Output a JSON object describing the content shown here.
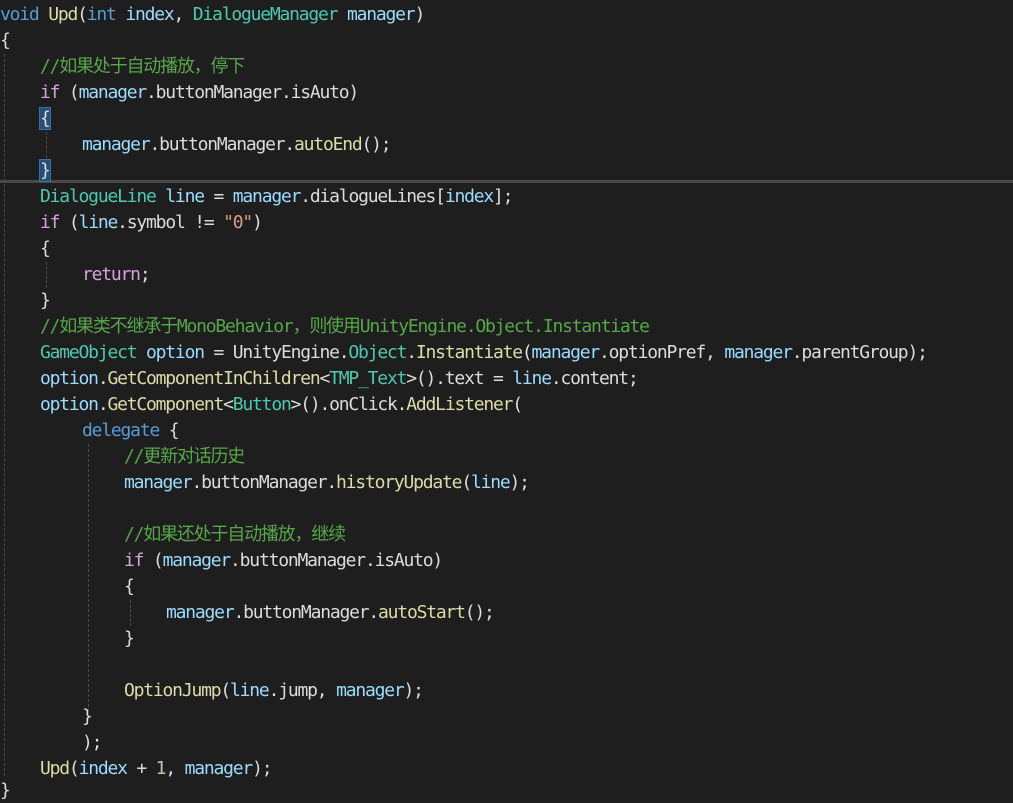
{
  "colors": {
    "background": "#1e1e1e",
    "keyword": "#569cd6",
    "type": "#4ec9b0",
    "method": "#dcdcaa",
    "parameter": "#9cdcfe",
    "plain": "#dcdcdc",
    "comment": "#57a64a",
    "string": "#d69d85",
    "number": "#b5cea8",
    "control": "#d8a0df",
    "brace_highlight": "#264f78"
  },
  "code_lines": [
    [
      [
        "kw",
        "void "
      ],
      [
        "method",
        "Upd"
      ],
      [
        "plain",
        "("
      ],
      [
        "kw",
        "int"
      ],
      [
        "plain",
        " "
      ],
      [
        "param",
        "index"
      ],
      [
        "plain",
        ", "
      ],
      [
        "type",
        "DialogueManager"
      ],
      [
        "plain",
        " "
      ],
      [
        "param",
        "manager"
      ],
      [
        "plain",
        ")"
      ]
    ],
    [
      [
        "plain",
        "{"
      ]
    ],
    [
      [
        "comment",
        "//如果处于自动播放，停下"
      ]
    ],
    [
      [
        "ctrl",
        "if"
      ],
      [
        "plain",
        " ("
      ],
      [
        "param",
        "manager"
      ],
      [
        "plain",
        "."
      ],
      [
        "plain",
        "buttonManager"
      ],
      [
        "plain",
        "."
      ],
      [
        "plain",
        "isAuto"
      ],
      [
        "plain",
        ")"
      ]
    ],
    [
      [
        "plain",
        "{"
      ]
    ],
    [
      [
        "param",
        "manager"
      ],
      [
        "plain",
        "."
      ],
      [
        "plain",
        "buttonManager"
      ],
      [
        "plain",
        "."
      ],
      [
        "method",
        "autoEnd"
      ],
      [
        "plain",
        "();"
      ]
    ],
    [
      [
        "plain",
        "}"
      ]
    ],
    [
      [
        "type",
        "DialogueLine"
      ],
      [
        "plain",
        " "
      ],
      [
        "param",
        "line"
      ],
      [
        "plain",
        " = "
      ],
      [
        "param",
        "manager"
      ],
      [
        "plain",
        "."
      ],
      [
        "plain",
        "dialogueLines"
      ],
      [
        "plain",
        "["
      ],
      [
        "param",
        "index"
      ],
      [
        "plain",
        "];"
      ]
    ],
    [
      [
        "ctrl",
        "if"
      ],
      [
        "plain",
        " ("
      ],
      [
        "param",
        "line"
      ],
      [
        "plain",
        "."
      ],
      [
        "plain",
        "symbol"
      ],
      [
        "plain",
        " != "
      ],
      [
        "string",
        "\"0\""
      ],
      [
        "plain",
        ")"
      ]
    ],
    [
      [
        "plain",
        "{"
      ]
    ],
    [
      [
        "ctrl",
        "return"
      ],
      [
        "plain",
        ";"
      ]
    ],
    [
      [
        "plain",
        "}"
      ]
    ],
    [
      [
        "comment",
        "//如果类不继承于MonoBehavior，则使用UnityEngine.Object.Instantiate"
      ]
    ],
    [
      [
        "type",
        "GameObject"
      ],
      [
        "plain",
        " "
      ],
      [
        "param",
        "option"
      ],
      [
        "plain",
        " = "
      ],
      [
        "plain",
        "UnityEngine"
      ],
      [
        "plain",
        "."
      ],
      [
        "type",
        "Object"
      ],
      [
        "plain",
        "."
      ],
      [
        "method",
        "Instantiate"
      ],
      [
        "plain",
        "("
      ],
      [
        "param",
        "manager"
      ],
      [
        "plain",
        "."
      ],
      [
        "plain",
        "optionPref"
      ],
      [
        "plain",
        ", "
      ],
      [
        "param",
        "manager"
      ],
      [
        "plain",
        "."
      ],
      [
        "plain",
        "parentGroup"
      ],
      [
        "plain",
        ");"
      ]
    ],
    [
      [
        "param",
        "option"
      ],
      [
        "plain",
        "."
      ],
      [
        "method",
        "GetComponentInChildren"
      ],
      [
        "plain",
        "<"
      ],
      [
        "type",
        "TMP_Text"
      ],
      [
        "plain",
        ">()."
      ],
      [
        "plain",
        "text"
      ],
      [
        "plain",
        " = "
      ],
      [
        "param",
        "line"
      ],
      [
        "plain",
        "."
      ],
      [
        "plain",
        "content"
      ],
      [
        "plain",
        ";"
      ]
    ],
    [
      [
        "param",
        "option"
      ],
      [
        "plain",
        "."
      ],
      [
        "method",
        "GetComponent"
      ],
      [
        "plain",
        "<"
      ],
      [
        "type",
        "Button"
      ],
      [
        "plain",
        ">()."
      ],
      [
        "plain",
        "onClick"
      ],
      [
        "plain",
        "."
      ],
      [
        "method",
        "AddListener"
      ],
      [
        "plain",
        "("
      ]
    ],
    [
      [
        "kw",
        "delegate"
      ],
      [
        "plain",
        " {"
      ]
    ],
    [
      [
        "comment",
        "//更新对话历史"
      ]
    ],
    [
      [
        "param",
        "manager"
      ],
      [
        "plain",
        "."
      ],
      [
        "plain",
        "buttonManager"
      ],
      [
        "plain",
        "."
      ],
      [
        "method",
        "historyUpdate"
      ],
      [
        "plain",
        "("
      ],
      [
        "param",
        "line"
      ],
      [
        "plain",
        ");"
      ]
    ],
    [],
    [
      [
        "comment",
        "//如果还处于自动播放，继续"
      ]
    ],
    [
      [
        "ctrl",
        "if"
      ],
      [
        "plain",
        " ("
      ],
      [
        "param",
        "manager"
      ],
      [
        "plain",
        "."
      ],
      [
        "plain",
        "buttonManager"
      ],
      [
        "plain",
        "."
      ],
      [
        "plain",
        "isAuto"
      ],
      [
        "plain",
        ")"
      ]
    ],
    [
      [
        "plain",
        "{"
      ]
    ],
    [
      [
        "param",
        "manager"
      ],
      [
        "plain",
        "."
      ],
      [
        "plain",
        "buttonManager"
      ],
      [
        "plain",
        "."
      ],
      [
        "method",
        "autoStart"
      ],
      [
        "plain",
        "();"
      ]
    ],
    [
      [
        "plain",
        "}"
      ]
    ],
    [],
    [
      [
        "method",
        "OptionJump"
      ],
      [
        "plain",
        "("
      ],
      [
        "param",
        "line"
      ],
      [
        "plain",
        "."
      ],
      [
        "plain",
        "jump"
      ],
      [
        "plain",
        ", "
      ],
      [
        "param",
        "manager"
      ],
      [
        "plain",
        ");"
      ]
    ],
    [
      [
        "plain",
        "}"
      ]
    ],
    [
      [
        "plain",
        ");"
      ]
    ],
    [
      [
        "method",
        "Upd"
      ],
      [
        "plain",
        "("
      ],
      [
        "param",
        "index"
      ],
      [
        "plain",
        " + "
      ],
      [
        "number",
        "1"
      ],
      [
        "plain",
        ", "
      ],
      [
        "param",
        "manager"
      ],
      [
        "plain",
        ");"
      ]
    ],
    [
      [
        "plain",
        "}"
      ]
    ]
  ]
}
